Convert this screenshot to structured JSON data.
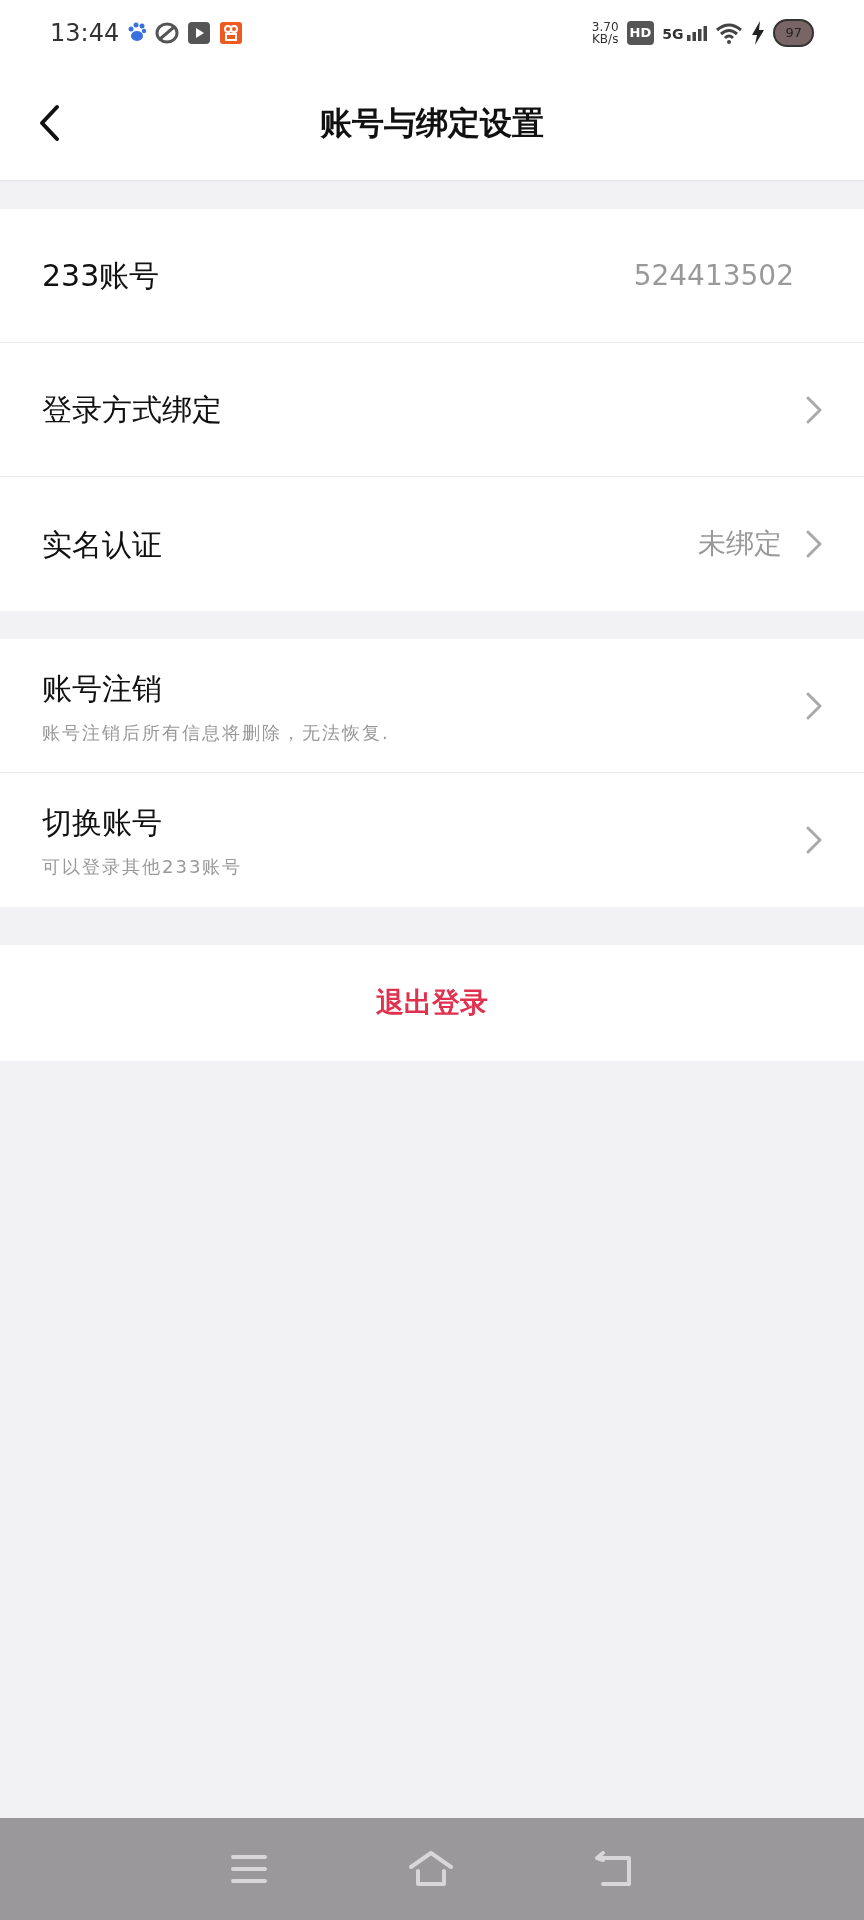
{
  "status_bar": {
    "time": "13:44",
    "net_speed": "3.70",
    "net_unit": "KB/s",
    "hd": "HD",
    "network": "5G",
    "battery": "97"
  },
  "header": {
    "title": "账号与绑定设置"
  },
  "groups": [
    {
      "rows": [
        {
          "label": "233账号",
          "value": "524413502",
          "arrow": false
        },
        {
          "label": "登录方式绑定",
          "arrow": true
        },
        {
          "label": "实名认证",
          "value": "未绑定",
          "arrow": true
        }
      ]
    },
    {
      "rows": [
        {
          "label": "账号注销",
          "subtitle": "账号注销后所有信息将删除，无法恢复.",
          "arrow": true
        },
        {
          "label": "切换账号",
          "subtitle": "可以登录其他233账号",
          "arrow": true
        }
      ]
    }
  ],
  "logout_button": "退出登录"
}
